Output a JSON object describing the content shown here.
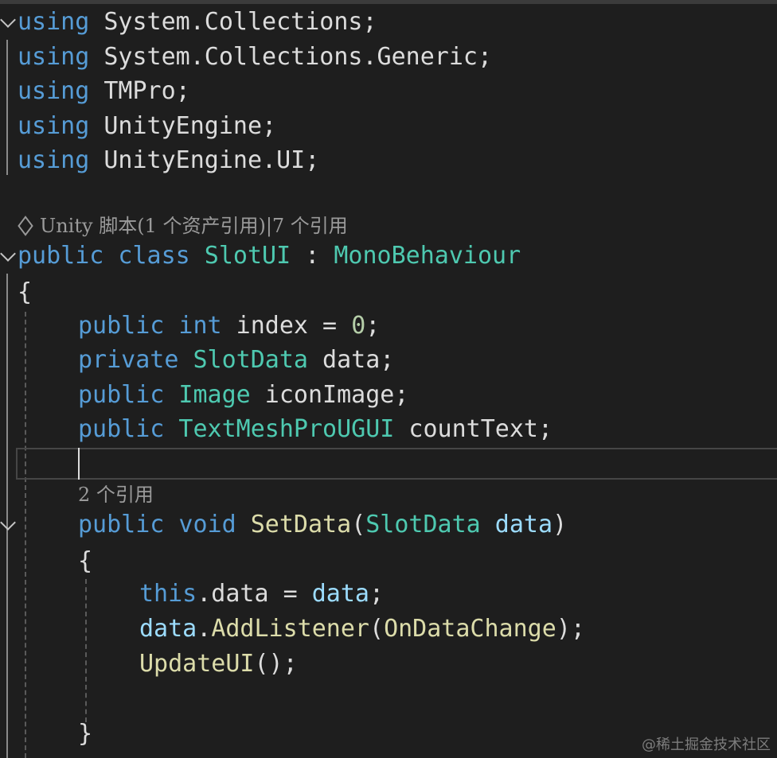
{
  "editor": {
    "usings": [
      {
        "kw": "using",
        "ns": " System.Collections",
        "end": ";"
      },
      {
        "kw": "using",
        "ns": " System.Collections.Generic",
        "end": ";"
      },
      {
        "kw": "using",
        "ns": " TMPro",
        "end": ";"
      },
      {
        "kw": "using",
        "ns": " UnityEngine",
        "end": ";"
      },
      {
        "kw": "using",
        "ns": " UnityEngine.UI",
        "end": ";"
      }
    ],
    "class_lens": "Unity 脚本(1 个资产引用)|7 个引用",
    "class_decl": {
      "kw_public": "public",
      "kw_class": " class",
      "name": " SlotUI",
      "colon": " : ",
      "base": "MonoBehaviour"
    },
    "open_brace": "{",
    "fields": [
      {
        "mod": "public",
        "type": " int",
        "rest": " index = ",
        "num": "0",
        "end": ";"
      },
      {
        "mod": "private",
        "type": " SlotData",
        "rest": " data;"
      },
      {
        "mod": "public",
        "type": " Image",
        "rest": " iconImage;"
      },
      {
        "mod": "public",
        "type": " TextMeshProUGUI",
        "rest": " countText;"
      }
    ],
    "method_lens": "2 个引用",
    "method_decl": {
      "mod": "public",
      "ret": " void",
      "name": " SetData",
      "open": "(",
      "ptype": "SlotData",
      "pname": " data",
      "close": ")"
    },
    "method_open": "{",
    "body": [
      {
        "a": "this",
        "b": ".data = ",
        "c": "data",
        "d": ";"
      },
      {
        "a": "data",
        "b": ".",
        "c": "AddListener",
        "d": "(",
        "e": "OnDataChange",
        "f": ");"
      },
      {
        "a": "UpdateUI",
        "b": "();"
      }
    ],
    "method_close": "}"
  },
  "watermark": "@稀土掘金技术社区",
  "colors": {
    "background": "#1e1e1e",
    "keyword": "#569cd6",
    "type": "#4ec9b0",
    "method": "#dcdcaa",
    "parameter": "#9cdcfe",
    "number": "#b5cea8",
    "plain": "#dcdcdc",
    "codelens": "#9a9a9a"
  }
}
